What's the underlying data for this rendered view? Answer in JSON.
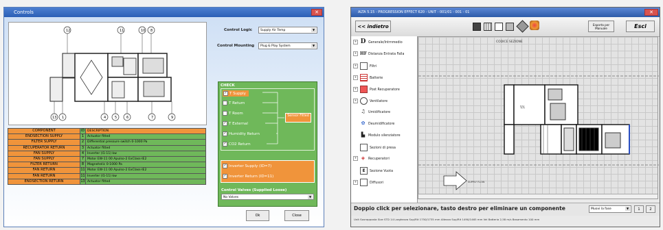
{
  "left_window": {
    "title": "Controls",
    "control_logic_label": "Control Logic",
    "control_logic_value": "Supply Air Temp",
    "control_mounting_label": "Control Mounting",
    "control_mounting_value": "Plug & Play System",
    "diagram_numbers_top": [
      "12",
      "11",
      "10",
      "8"
    ],
    "diagram_numbers_bottom": [
      "13",
      "1",
      "4",
      "5",
      "6",
      "7",
      "9"
    ],
    "table": {
      "header": [
        "COMPONENT",
        "ID",
        "DESCRIPTION"
      ],
      "rows": [
        [
          "ENDSECTION SUPPLY",
          "1",
          "Actuator fitted"
        ],
        [
          "FILTER SUPPLY",
          "2",
          "Differential pressure switch 0-1000 Pa"
        ],
        [
          "RECUPERATOR RETURN",
          "3",
          "Actuator fitted"
        ],
        [
          "FAN SUPPLY",
          "4",
          "Inverter (I1-11) kw"
        ],
        [
          "FAN SUPPLY",
          "7",
          "Motor EW-11 00 Apulso-2 ExClass-IE2"
        ],
        [
          "FILTER RETURN",
          "8",
          "Magnehelic 0-1000 Pa"
        ],
        [
          "FAN RETURN",
          "11",
          "Motor EW-11 00 Apulso-2 ExClass-IE2"
        ],
        [
          "FAN RETURN",
          "11",
          "Inverter (I1-11) kw"
        ],
        [
          "ENDSECTION RETURN",
          "13",
          "Actuator fitted"
        ]
      ]
    },
    "check": {
      "title": "CHECK",
      "items": [
        {
          "label": "T Supply",
          "checked": true,
          "highlighted": true
        },
        {
          "label": "T Return",
          "checked": false,
          "highlighted": false
        },
        {
          "label": "T Room",
          "checked": false,
          "highlighted": false
        },
        {
          "label": "T External",
          "checked": true,
          "highlighted": false
        },
        {
          "label": "Humidity Return",
          "checked": true,
          "highlighted": false
        },
        {
          "label": "CO2 Return",
          "checked": true,
          "highlighted": false
        }
      ],
      "sensor_badge": "Sensor Fitted",
      "inverters": [
        {
          "label": "Inverter Supply (ID=7)",
          "checked": true
        },
        {
          "label": "Inverter Return (ID=11)",
          "checked": true
        }
      ],
      "valves_label": "Control Valves (Supplied Loose)",
      "valves_value": "No Valves"
    },
    "ok_label": "Ok",
    "close_label": "Close"
  },
  "right_window": {
    "title": "ALTA 5.15 - PROGRESSION EFFECT 620 - UNIT - 001/01 - 001 - 01",
    "back_label": "<< indietro",
    "toolbar_icons": [
      "monitor-icon",
      "grid-icon",
      "window-icon",
      "print-icon",
      "tools-icon",
      "palette-icon"
    ],
    "export_label_1": "Esporta per",
    "export_label_2": "Manuale",
    "exit_label": "Esci",
    "sidebar": [
      {
        "icon": "D",
        "label": "Generale/Intrnmedio"
      },
      {
        "icon": "HF",
        "label": "Distanza Entrata Falla"
      },
      {
        "icon": "Fi",
        "label": "Filtri"
      },
      {
        "icon": "Ba",
        "label": "Batterie"
      },
      {
        "icon": "Re",
        "label": "Post Recuperatore"
      },
      {
        "icon": "Ve",
        "label": "Ventilatore"
      },
      {
        "icon": "Um",
        "label": "Umidificatore"
      },
      {
        "icon": "De",
        "label": "Deumidificatore"
      },
      {
        "icon": "Mo",
        "label": "Modulo silenziatore"
      },
      {
        "icon": "Se",
        "label": "Sezioni di presa"
      },
      {
        "icon": "Rc",
        "label": "Recuperatori"
      },
      {
        "icon": "Sv",
        "label": "Sezione Vuota"
      },
      {
        "icon": "Di",
        "label": "Diffusori"
      }
    ],
    "canvas_label": "CODICE SEZIONE",
    "arrow_label": "SUPPLY FLOW",
    "status_text": "Doppio click per selezionare, tasto destro per eliminare un componente",
    "mode_select": "Muovi la fase",
    "page_buttons": [
      "1",
      "2"
    ],
    "footer": "Unit Sovrapposta  Size STD 14  Larghezza Sup/Rit 1750/1735 mm  Altezza Sup/Rit 1490/1465 mm  Vel Batteria 2,58 m/s  Basamento 100 mm"
  }
}
